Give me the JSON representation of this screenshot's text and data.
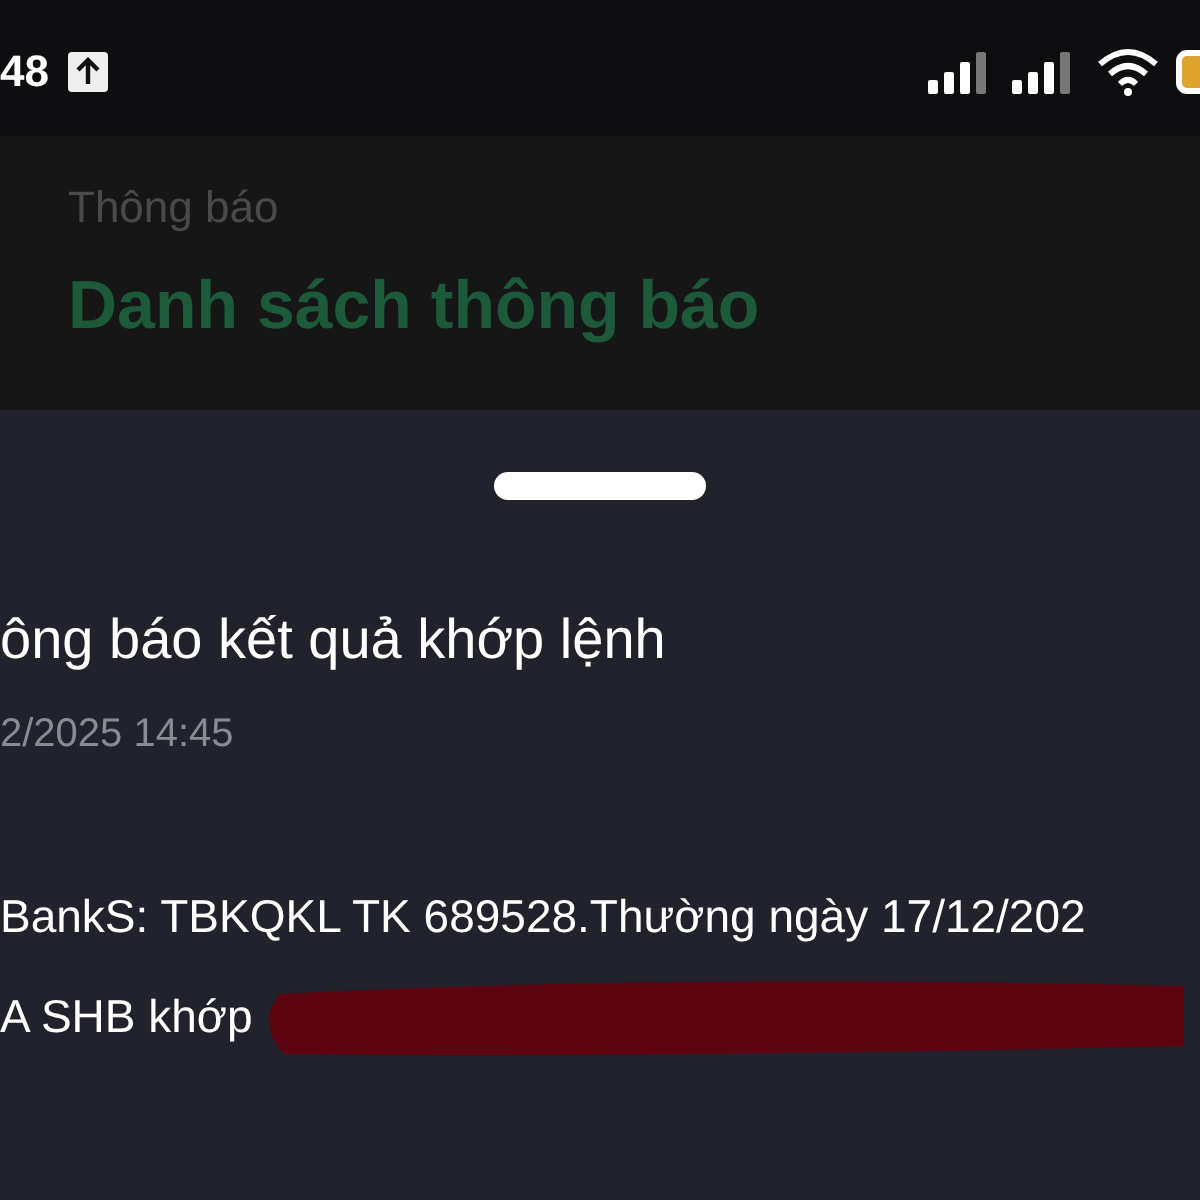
{
  "status_bar": {
    "time": "48"
  },
  "header": {
    "subtitle": "Thông báo",
    "title": "Danh sách thông báo"
  },
  "notification": {
    "title": "ông báo kết quả khớp lệnh",
    "timestamp": "2/2025 14:45",
    "body_lines": [
      "BankS: TBKQKL TK 689528.Thường ngày 17/12/202",
      "A SHB khớp"
    ]
  }
}
